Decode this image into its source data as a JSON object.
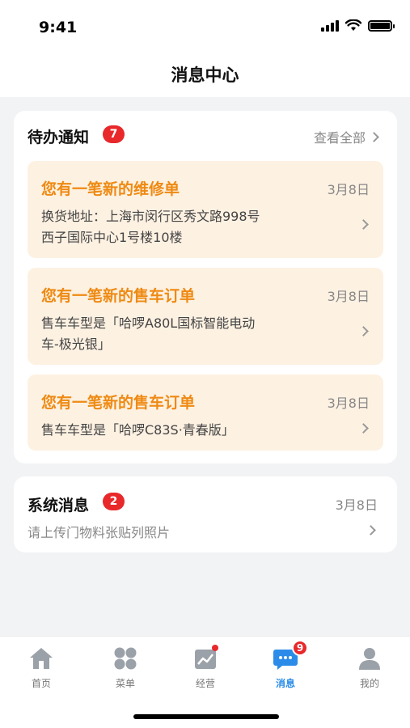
{
  "status_bar": {
    "time": "9:41"
  },
  "nav": {
    "title": "消息中心"
  },
  "todo": {
    "title": "待办通知",
    "badge": "7",
    "view_all": "查看全部",
    "items": [
      {
        "title": "您有一笔新的维修单",
        "date": "3月8日",
        "line1": "换货地址：上海市闵行区秀文路998号",
        "line2": "西子国际中心1号楼10楼"
      },
      {
        "title": "您有一笔新的售车订单",
        "date": "3月8日",
        "line1": "售车车型是「哈啰A80L国标智能电动",
        "line2": "车-极光银」"
      },
      {
        "title": "您有一笔新的售车订单",
        "date": "3月8日",
        "line1": "售车车型是「哈啰C83S·青春版」",
        "line2": ""
      }
    ]
  },
  "system": {
    "title": "系统消息",
    "badge": "2",
    "date": "3月8日",
    "text": "请上传门物料张贴列照片"
  },
  "tabs": [
    {
      "label": "首页",
      "icon": "home-icon"
    },
    {
      "label": "菜单",
      "icon": "grid-icon"
    },
    {
      "label": "经营",
      "icon": "chart-icon"
    },
    {
      "label": "消息",
      "icon": "message-icon",
      "badge": "9"
    },
    {
      "label": "我的",
      "icon": "user-icon"
    }
  ],
  "colors": {
    "accent": "#2a8ce8",
    "todo_title": "#ee8a13",
    "todo_bg": "#fdf1e2",
    "badge": "#e8282b"
  }
}
